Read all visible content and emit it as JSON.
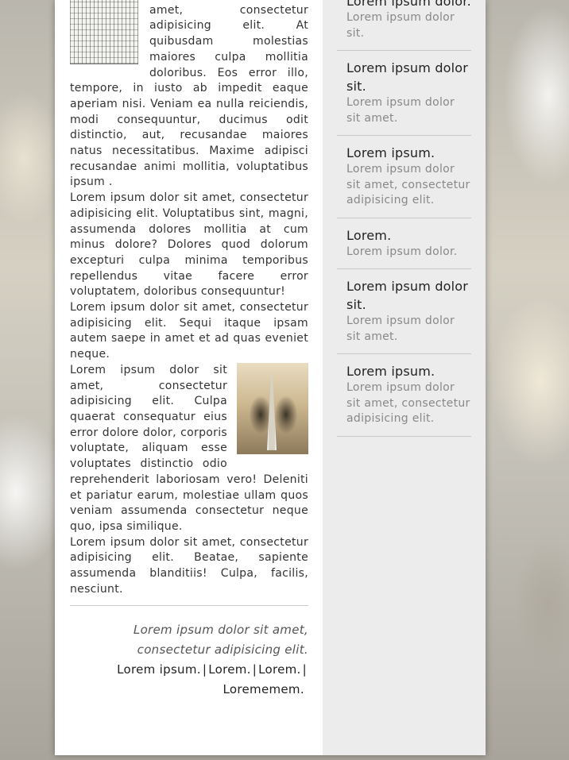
{
  "main": {
    "paragraphs": [
      "Lorem ipsum dolor sit amet, consectetur adipisicing elit. At quibusdam molestias maiores culpa mollitia doloribus. Eos error illo, tempore, in iusto ab impedit eaque aperiam nisi. Veniam ea nulla reiciendis, modi consequuntur, ducimus odit distinctio, aut, recusandae maiores natus necessitatibus. Maxime adipisci recusandae animi mollitia, voluptatibus ipsum .",
      "Lorem ipsum dolor sit amet, consectetur adipisicing elit. Voluptatibus sint, magni, assumenda dolores mollitia at cum minus dolore? Dolores quod dolorum excepturi culpa minima temporibus repellendus vitae facere error voluptatem, doloribus consequuntur!",
      "Lorem ipsum dolor sit amet, consectetur adipisicing elit. Sequi itaque ipsam autem saepe in amet et ad quas eveniet neque.",
      "Lorem ipsum dolor sit amet, consectetur adipisicing elit. Culpa quaerat consequatur eius error dolore dolor, corporis voluptate, aliquam esse voluptates distinctio odio reprehenderit laboriosam vero! Deleniti et pariatur earum, molestiae ullam quos veniam assumenda consectetur neque quo, ipsa similique.",
      "Lorem ipsum dolor sit amet, consectetur adipisicing elit. Beatae, sapiente assumenda blanditiis! Culpa, facilis, nesciunt."
    ],
    "images": [
      "technical-drawing-image",
      "steampunk-tower-image"
    ]
  },
  "footer": {
    "quote_line1": "Lorem ipsum dolor sit amet,",
    "quote_line2": "consectetur adipisicing elit.",
    "links": [
      "Lorem ipsum.",
      "Lorem.",
      "Lorem.",
      "Lorememem."
    ],
    "separator": "|"
  },
  "sidebar": {
    "items": [
      {
        "title": "Lorem ipsum dolor.",
        "desc": "Lorem ipsum dolor sit."
      },
      {
        "title": "Lorem ipsum dolor sit.",
        "desc": "Lorem ipsum dolor sit amet."
      },
      {
        "title": "Lorem ipsum.",
        "desc": "Lorem ipsum dolor sit amet, consectetur adipisicing elit."
      },
      {
        "title": "Lorem.",
        "desc": "Lorem ipsum dolor."
      },
      {
        "title": "Lorem ipsum dolor sit.",
        "desc": "Lorem ipsum dolor sit amet."
      },
      {
        "title": "Lorem ipsum.",
        "desc": "Lorem ipsum dolor sit amet, consectetur adipisicing elit."
      }
    ]
  },
  "colors": {
    "page_background": "#ffffff",
    "sidebar_background": "#ececec",
    "body_text": "#333333",
    "muted_text": "#888888"
  }
}
